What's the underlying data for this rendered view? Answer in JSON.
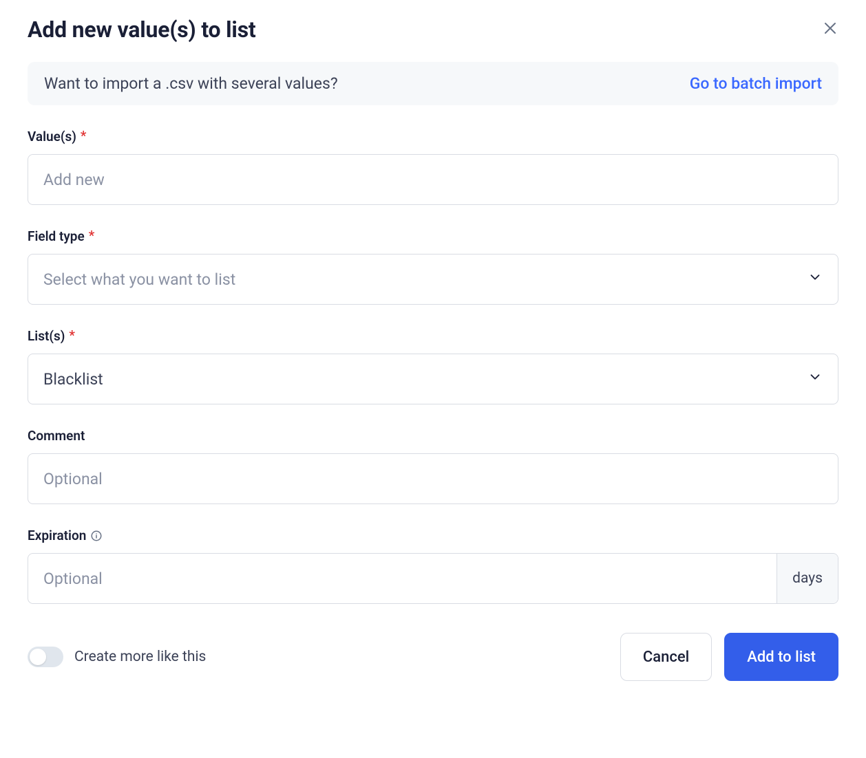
{
  "dialog": {
    "title": "Add new value(s) to list"
  },
  "banner": {
    "text": "Want to import a .csv with several values?",
    "link_label": "Go to batch import"
  },
  "fields": {
    "values": {
      "label": "Value(s)",
      "required_indicator": "*",
      "placeholder": "Add new",
      "value": ""
    },
    "field_type": {
      "label": "Field type",
      "required_indicator": "*",
      "placeholder": "Select what you want to list",
      "value": ""
    },
    "lists": {
      "label": "List(s)",
      "required_indicator": "*",
      "value": "Blacklist"
    },
    "comment": {
      "label": "Comment",
      "placeholder": "Optional",
      "value": ""
    },
    "expiration": {
      "label": "Expiration",
      "placeholder": "Optional",
      "suffix": "days",
      "value": ""
    }
  },
  "footer": {
    "toggle_label": "Create more like this",
    "toggle_on": false,
    "cancel_label": "Cancel",
    "submit_label": "Add to list"
  }
}
